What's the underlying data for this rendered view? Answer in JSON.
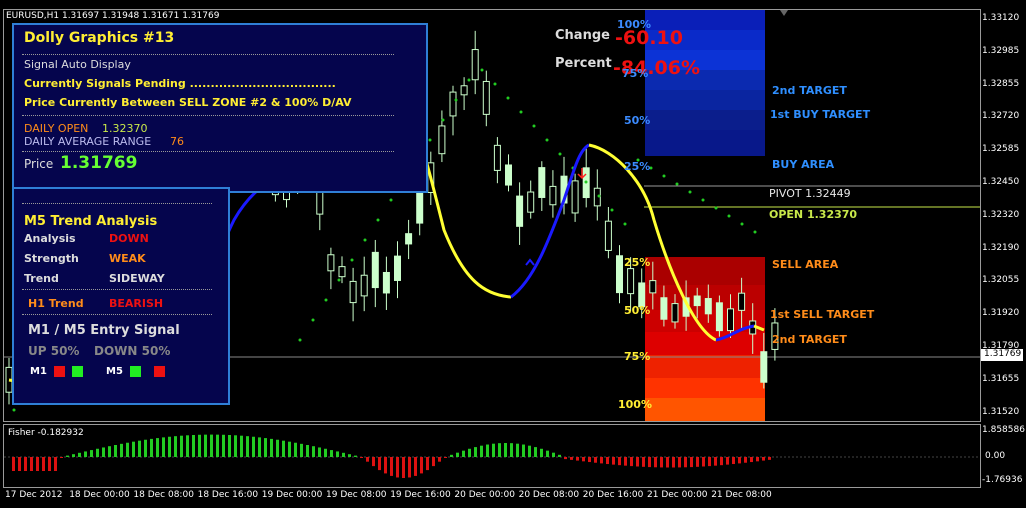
{
  "chart_title": "EURUSD,H1  1.31697 1.31948 1.31671 1.31769",
  "price_axis": [
    "1.33120",
    "1.32985",
    "1.32855",
    "1.32720",
    "1.32585",
    "1.32450",
    "1.32320",
    "1.32190",
    "1.32055",
    "1.31920",
    "1.31790",
    "1.31655",
    "1.31520"
  ],
  "current_price_tag": "1.31769",
  "time_axis": [
    "17 Dec 2012",
    "18 Dec 00:00",
    "18 Dec 08:00",
    "18 Dec 16:00",
    "19 Dec 00:00",
    "19 Dec 08:00",
    "19 Dec 16:00",
    "20 Dec 00:00",
    "20 Dec 08:00",
    "20 Dec 16:00",
    "21 Dec 00:00",
    "21 Dec 08:00"
  ],
  "change": {
    "label": "Change",
    "value": "-60.10"
  },
  "percent": {
    "label": "Percent",
    "value": "-84.06%"
  },
  "panel1": {
    "title": "Dolly Graphics #13",
    "subtitle": "Signal Auto Display",
    "signals": "Currently Signals Pending ...................................",
    "zone": "Price Currently Between SELL ZONE #2 & 100% D/AV",
    "daily_open_label": "DAILY OPEN",
    "daily_open_value": "1.32370",
    "dar_label": "DAILY AVERAGE RANGE",
    "dar_value": "76",
    "price_label": "Price",
    "price_value": "1.31769"
  },
  "panel2": {
    "title": "M5 Trend Analysis",
    "rows": [
      {
        "label": "Analysis",
        "value": "DOWN"
      },
      {
        "label": "Strength",
        "value": "WEAK"
      },
      {
        "label": "Trend",
        "value": "SIDEWAY"
      }
    ],
    "h1_label": "H1 Trend",
    "h1_value": "BEARISH",
    "entry_title": "M1 /  M5 Entry Signal",
    "up": "UP 50%",
    "down": "DOWN 50%",
    "m1": "M1",
    "m5": "M5"
  },
  "zones": {
    "top_pcts": [
      "100%",
      "75%",
      "50%",
      "25%"
    ],
    "bottom_pcts": [
      "25%",
      "50%",
      "75%",
      "100%"
    ],
    "labels": {
      "target2_up": "2nd TARGET",
      "buy_target1": "1st BUY TARGET",
      "buy_area": "BUY AREA",
      "pivot": "PIVOT 1.32449",
      "open": "OPEN 1.32370",
      "sell_area": "SELL AREA",
      "sell_target1": "1st SELL TARGET",
      "target2_down": "2nd TARGET"
    }
  },
  "fisher": {
    "label": "Fisher -0.182932",
    "axis": [
      "1.858586",
      "0.00",
      "-1.76936"
    ]
  },
  "colors": {
    "up_candle": "#ccffcc",
    "bull_hist": "#22cc22",
    "bear_hist": "#dd1111",
    "yellow": "#ffff33",
    "blue": "#1a1aff",
    "sar": "#22cc22"
  }
}
